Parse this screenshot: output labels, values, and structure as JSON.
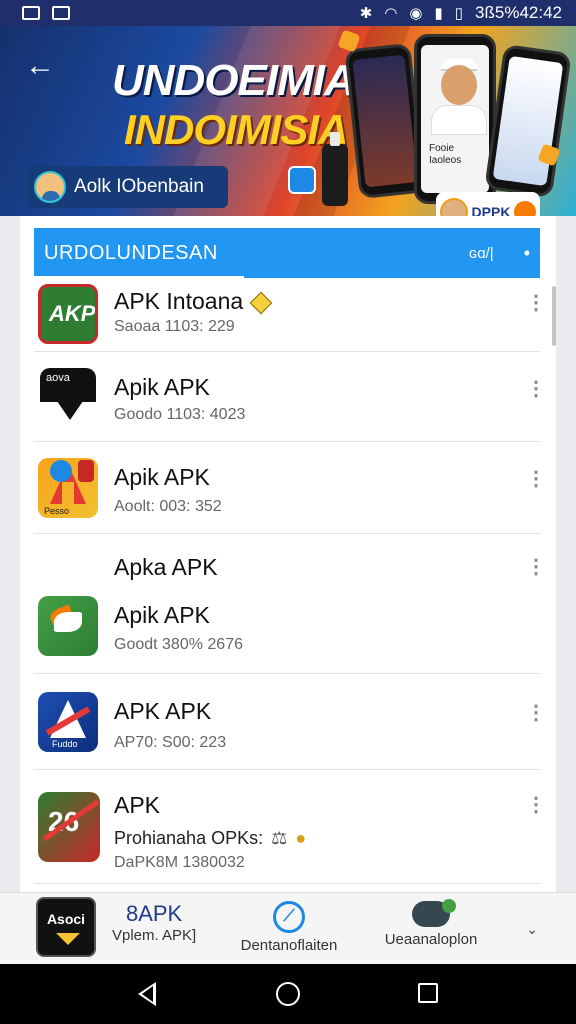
{
  "status_bar": {
    "clock": "3ß5%42:42"
  },
  "banner": {
    "title": "UNDOEIMIA",
    "subtitle": "INDOIMISIA",
    "developer_chip": "Aolk IObenbain",
    "phone_text": "Fooie\nIaoleos",
    "apk_tag": "DPPK"
  },
  "section": {
    "title": "URDOLUNDESAN",
    "count": "ɢɑ/|"
  },
  "apps": [
    {
      "name": "APK Intoana",
      "meta": "Saoaa  1103: 229"
    },
    {
      "name": "Apik APK",
      "meta": "Goodo  1103: 4023"
    },
    {
      "name": "Apik APK",
      "meta": "Aoolt:  003: 352"
    },
    {
      "name": "Apka APK",
      "meta": ""
    },
    {
      "name": "Apik APK",
      "meta": "Goodt  380%  2676"
    },
    {
      "name": "APK APK",
      "meta": "AP70:  S00: 223"
    },
    {
      "name": "APK",
      "meta": "Prohianaha OPKs:",
      "meta2": "DaPK8M 1380032"
    }
  ],
  "icon_labels": {
    "ic1": "AKP",
    "ic2": "aova",
    "ic3": "Pesso",
    "ic5": "Fuddo",
    "ic6": "26"
  },
  "bottom_bar": {
    "logo_text": "Asoci",
    "brand_top": "8APK",
    "brand_bottom": "Vplem. APK]",
    "tab2": "Dentanoflaiten",
    "tab3": "Ueaanaloplon"
  },
  "colors": {
    "accent": "#2196f3",
    "banner_dark": "#1f2f6b",
    "brand_text": "#1f3c88"
  }
}
